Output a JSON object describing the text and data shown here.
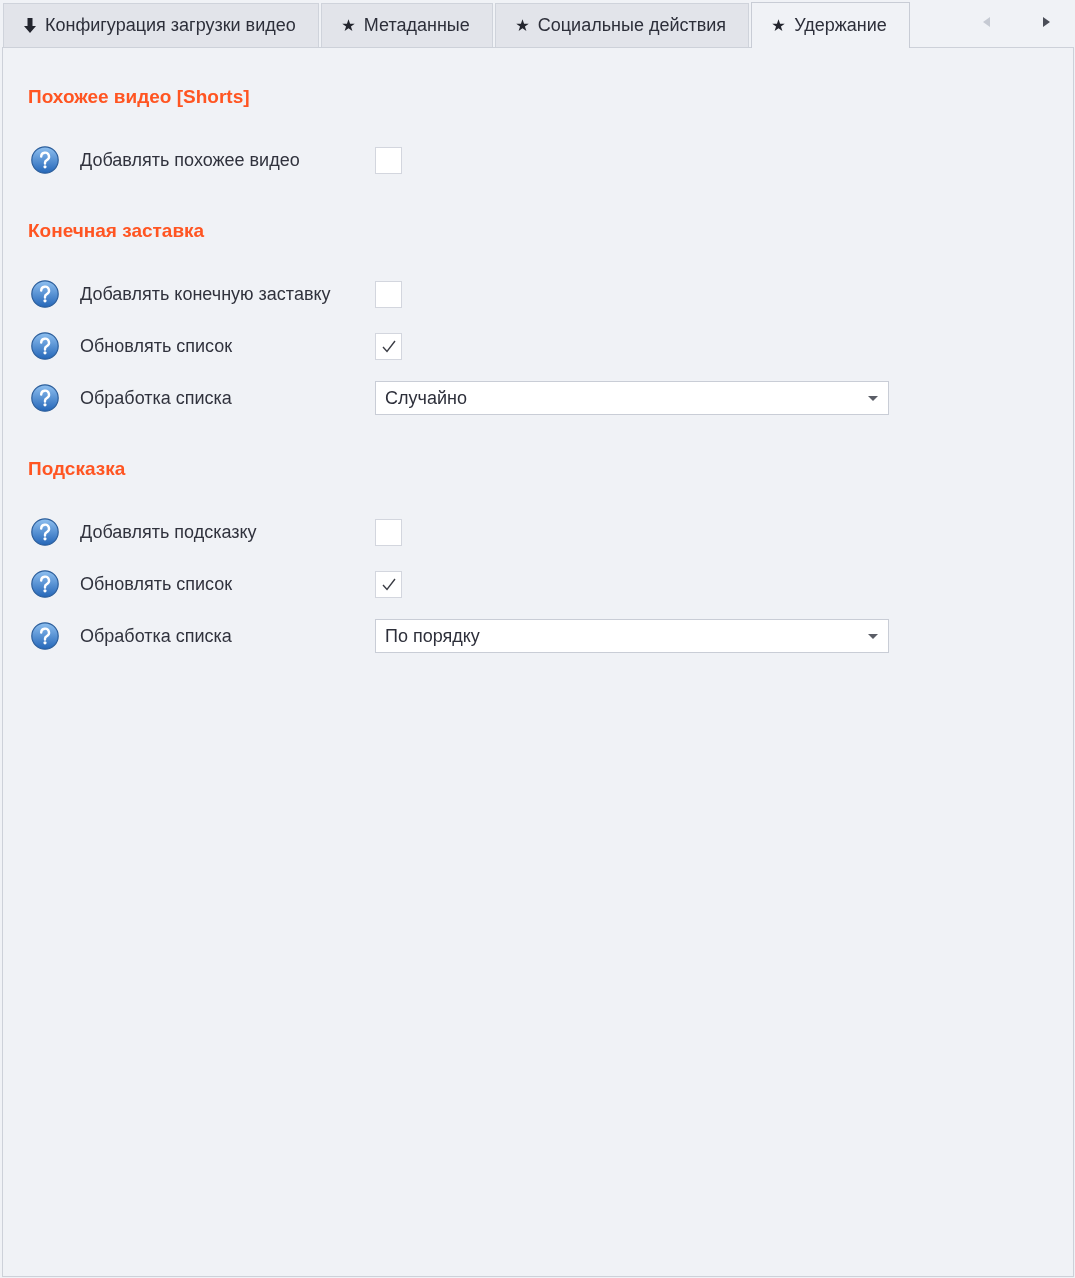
{
  "tabs": [
    {
      "kind": "download",
      "label": "Конфигурация загрузки видео",
      "selected": false
    },
    {
      "kind": "star",
      "label": "Метаданные",
      "selected": false
    },
    {
      "kind": "star",
      "label": "Социальные действия",
      "selected": false
    },
    {
      "kind": "star",
      "label": "Удержание",
      "selected": true
    }
  ],
  "tab_scroll": [
    {
      "kind": "left",
      "disabled": true
    },
    {
      "kind": "right",
      "disabled": false
    }
  ],
  "sections": [
    {
      "title": "Похожее видео [Shorts]",
      "fields": [
        {
          "kind": "checkbox",
          "label": "Добавлять похожее видео",
          "checked": false
        }
      ]
    },
    {
      "title": "Конечная заставка",
      "fields": [
        {
          "kind": "checkbox",
          "label": "Добавлять конечную заставку",
          "checked": false
        },
        {
          "kind": "checkbox",
          "label": "Обновлять список",
          "checked": true
        },
        {
          "kind": "select",
          "label": "Обработка списка",
          "value": "Случайно"
        }
      ]
    },
    {
      "title": "Подсказка",
      "fields": [
        {
          "kind": "checkbox",
          "label": "Добавлять подсказку",
          "checked": false
        },
        {
          "kind": "checkbox",
          "label": "Обновлять список",
          "checked": true
        },
        {
          "kind": "select",
          "label": "Обработка списка",
          "value": "По порядку"
        }
      ]
    }
  ]
}
